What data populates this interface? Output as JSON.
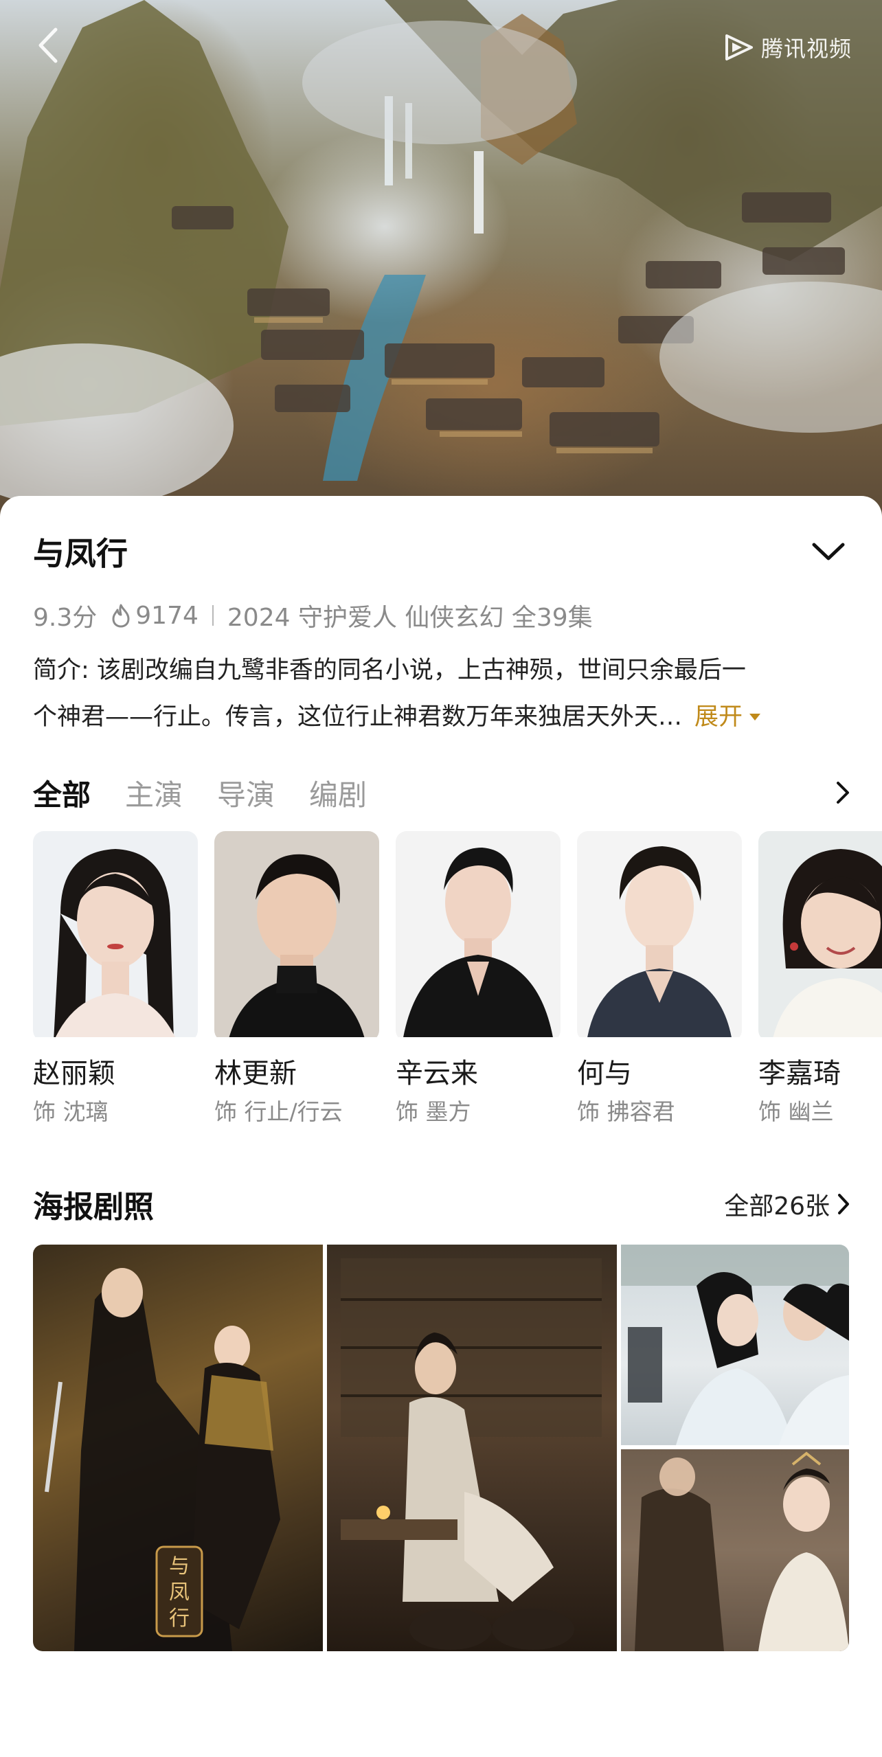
{
  "header": {
    "brand": "腾讯视频"
  },
  "show": {
    "title": "与凤行",
    "score": "9.3分",
    "heat": "9174",
    "tags": "2024 守护爱人 仙侠玄幻 全39集",
    "intro_line1": "简介: 该剧改编自九鹭非香的同名小说，上古神殒，世间只余最后一",
    "intro_line2": "个神君——行止。传言，这位行止神君数万年来独居天外天…",
    "expand_label": "展开"
  },
  "tabs": [
    {
      "label": "全部",
      "active": true
    },
    {
      "label": "主演",
      "active": false
    },
    {
      "label": "导演",
      "active": false
    },
    {
      "label": "编剧",
      "active": false
    }
  ],
  "cast": [
    {
      "name": "赵丽颖",
      "role": "饰 沈璃"
    },
    {
      "name": "林更新",
      "role": "饰 行止/行云"
    },
    {
      "name": "辛云来",
      "role": "饰 墨方"
    },
    {
      "name": "何与",
      "role": "饰 拂容君"
    },
    {
      "name": "李嘉琦",
      "role": "饰 幽兰"
    }
  ],
  "posters": {
    "title": "海报剧照",
    "all_label": "全部26张",
    "poster_logo_text": "与凤行"
  },
  "colors": {
    "accent": "#c08a1a",
    "muted": "#8a8a8a"
  }
}
